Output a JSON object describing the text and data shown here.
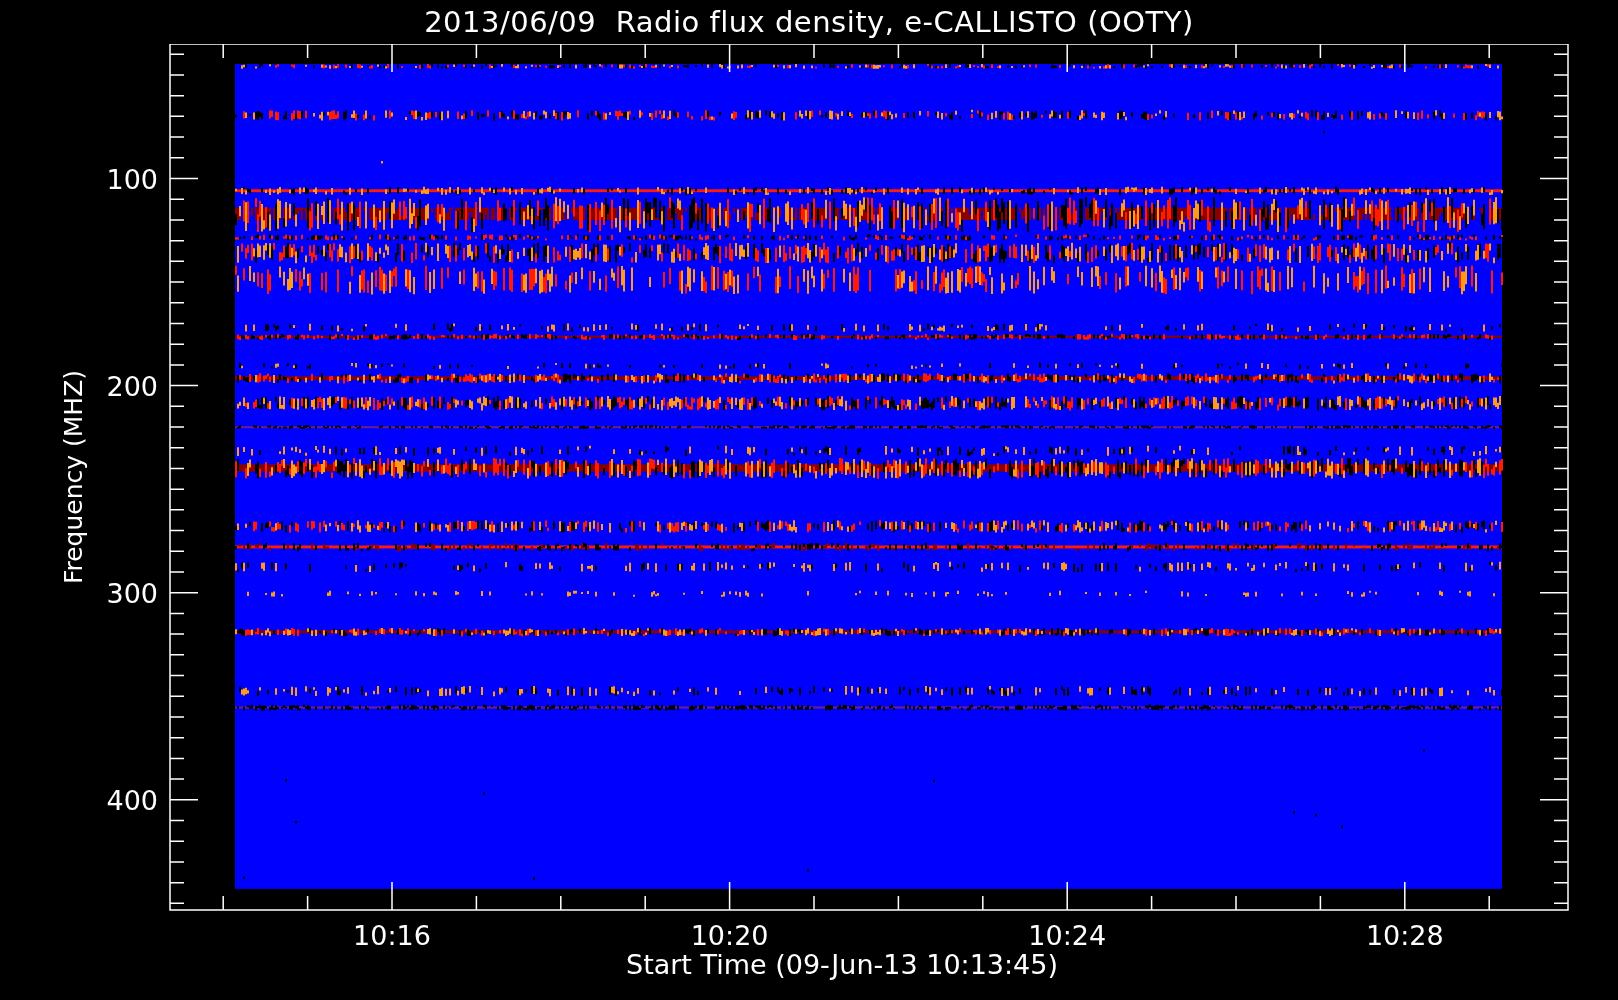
{
  "title": "2013/06/09  Radio flux density, e-CALLISTO (OOTY)",
  "plot": {
    "ylabel": "Frequency (MHZ)",
    "xlabel": "Start Time (09-Jun-13 10:13:45)",
    "yticks": [
      "100",
      "200",
      "300",
      "400"
    ],
    "xticks": [
      "10:16",
      "10:20",
      "10:24",
      "10:28"
    ]
  }
}
